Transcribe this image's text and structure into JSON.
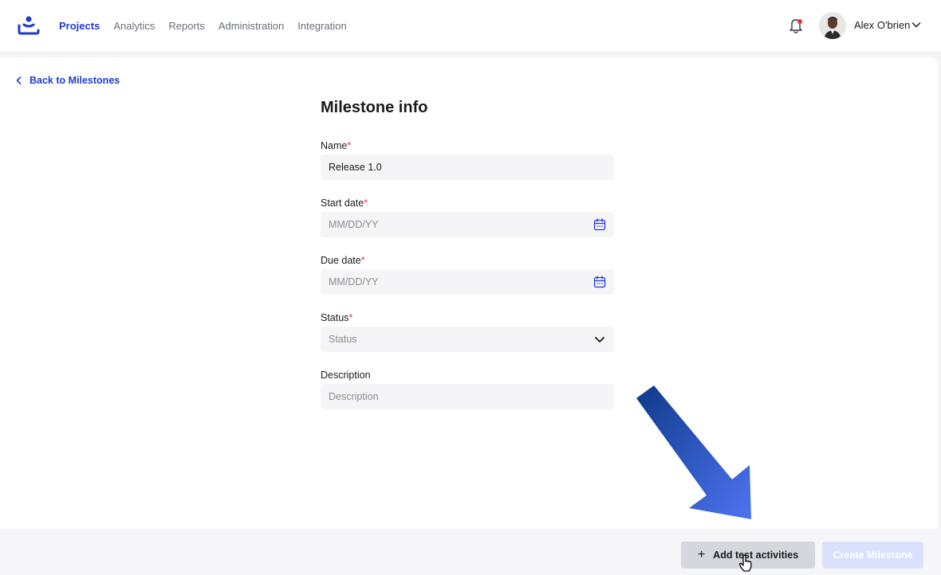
{
  "nav": {
    "logo_icon": "brand-logo-icon",
    "items": [
      {
        "label": "Projects",
        "active": true
      },
      {
        "label": "Analytics",
        "active": false
      },
      {
        "label": "Reports",
        "active": false
      },
      {
        "label": "Administration",
        "active": false
      },
      {
        "label": "Integration",
        "active": false
      }
    ]
  },
  "user": {
    "name": "Alex O'brien",
    "notification_icon": "bell-icon",
    "has_notification": true
  },
  "back_link": {
    "label": "Back to Milestones"
  },
  "form": {
    "title": "Milestone info",
    "fields": {
      "name": {
        "label": "Name",
        "required": "*",
        "value": "Release 1.0"
      },
      "start_date": {
        "label": "Start date",
        "required": "*",
        "placeholder": "MM/DD/YY"
      },
      "due_date": {
        "label": "Due date",
        "required": "*",
        "placeholder": "MM/DD/YY"
      },
      "status": {
        "label": "Status",
        "required": "*",
        "placeholder": "Status"
      },
      "description": {
        "label": "Description",
        "placeholder": "Description"
      }
    }
  },
  "actions": {
    "add_label": "Add test activities",
    "create_label": "Create Milestone"
  },
  "colors": {
    "accent": "#1f3bd1",
    "required": "#e5343d",
    "arrow": "#4a6ff0"
  }
}
